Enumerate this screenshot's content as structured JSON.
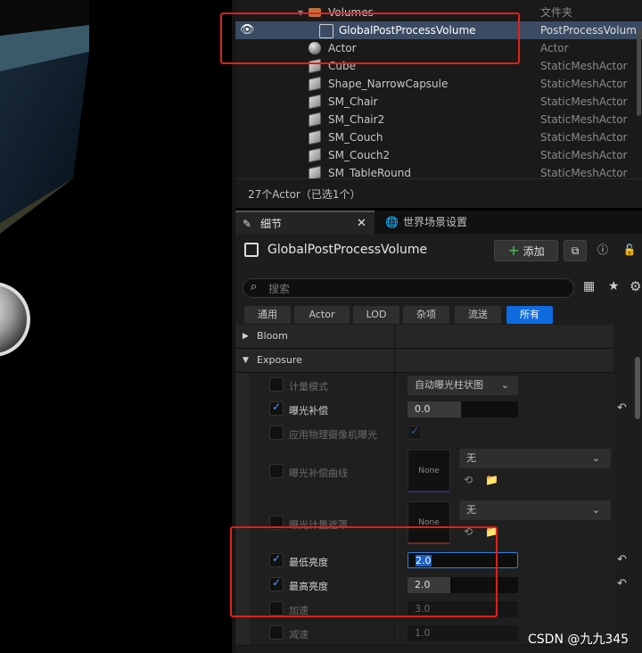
{
  "outliner": {
    "rows": [
      {
        "label": "Volumes",
        "type": "文件夹",
        "icon": "folder-icon"
      },
      {
        "label": "GlobalPostProcessVolume",
        "type": "PostProcessVolum",
        "icon": "post-process-volume-icon"
      },
      {
        "label": "Actor",
        "type": "Actor",
        "icon": "actor-sphere-icon"
      },
      {
        "label": "Cube",
        "type": "StaticMeshActor",
        "icon": "static-mesh-icon"
      },
      {
        "label": "Shape_NarrowCapsule",
        "type": "StaticMeshActor",
        "icon": "static-mesh-icon"
      },
      {
        "label": "SM_Chair",
        "type": "StaticMeshActor",
        "icon": "static-mesh-icon"
      },
      {
        "label": "SM_Chair2",
        "type": "StaticMeshActor",
        "icon": "static-mesh-icon"
      },
      {
        "label": "SM_Couch",
        "type": "StaticMeshActor",
        "icon": "static-mesh-icon"
      },
      {
        "label": "SM_Couch2",
        "type": "StaticMeshActor",
        "icon": "static-mesh-icon"
      },
      {
        "label": "SM_TableRound",
        "type": "StaticMeshActor",
        "icon": "static-mesh-icon"
      }
    ],
    "footer": "27个Actor（已选1个）"
  },
  "tabs": {
    "details": "细节",
    "world_settings": "世界场景设置"
  },
  "details": {
    "actor_name": "GlobalPostProcessVolume",
    "add_button": "添加",
    "search_placeholder": "搜索",
    "filters": [
      "通用",
      "Actor",
      "LOD",
      "杂项",
      "流送",
      "所有"
    ],
    "active_filter": "所有",
    "sections": {
      "bloom": "Bloom",
      "exposure": "Exposure"
    },
    "props": {
      "metering_mode": {
        "label": "计量模式",
        "value": "自动曝光柱状图"
      },
      "exposure_comp": {
        "label": "曝光补偿",
        "value": "0.0",
        "checked": true
      },
      "apply_physical_camera": {
        "label": "应用物理摄像机曝光"
      },
      "exposure_curve": {
        "label": "曝光补偿曲线",
        "thumb": "None",
        "value": "无"
      },
      "metering_mask": {
        "label": "曝光计量遮罩",
        "thumb": "None",
        "value": "无"
      },
      "min_brightness": {
        "label": "最低亮度",
        "value": "2.0",
        "checked": true
      },
      "max_brightness": {
        "label": "最高亮度",
        "value": "2.0",
        "checked": true
      },
      "speed_up": {
        "label": "加速",
        "value": "3.0"
      },
      "speed_down": {
        "label": "减速",
        "value": "1.0"
      }
    }
  },
  "watermark": "CSDN @九九345",
  "colors": {
    "accent": "#0e6be0",
    "selection": "#3a4b63",
    "annotation": "#e0201b"
  }
}
